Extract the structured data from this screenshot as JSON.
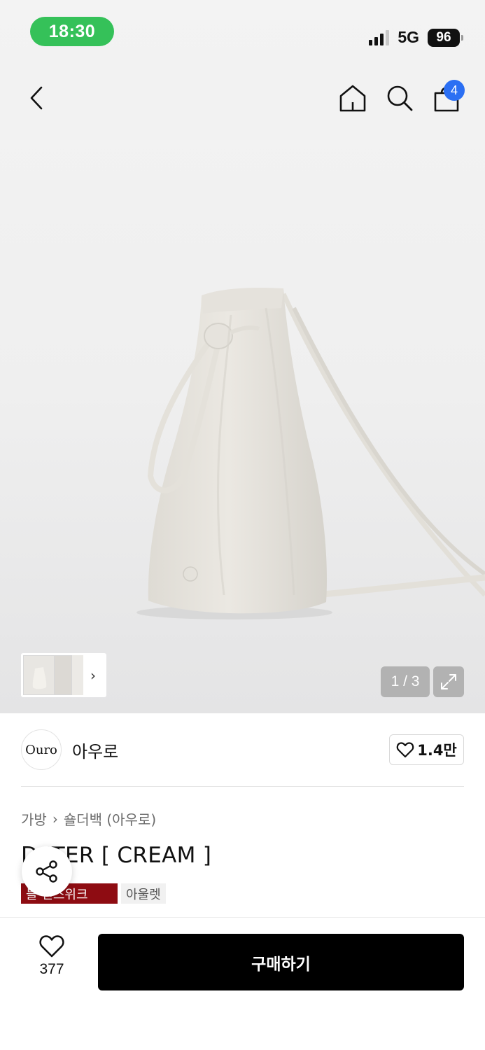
{
  "status_bar": {
    "time": "18:30",
    "network": "5G",
    "battery": "96"
  },
  "nav": {
    "cart_count": "4"
  },
  "gallery": {
    "page_indicator": "1 / 3"
  },
  "brand": {
    "logo_text": "Ouro",
    "name": "아우로",
    "likes": "1.4만"
  },
  "breadcrumb": {
    "category": "가방",
    "separator": "›",
    "subcategory": "숄더백 (아우로)"
  },
  "product": {
    "title": "D  ITER [ CREAM ]"
  },
  "tags": [
    {
      "label": "블  런스위크"
    },
    {
      "label": "아울렛"
    }
  ],
  "bottom": {
    "wish_count": "377",
    "buy_label": "구매하기"
  },
  "colors": {
    "status_green": "#35c159",
    "badge_blue": "#2b6ff3",
    "tag_red": "#8e0c12",
    "buy_black": "#000000"
  },
  "icons": [
    "back-icon",
    "home-icon",
    "search-icon",
    "shopping-bag-icon",
    "expand-icon",
    "heart-icon",
    "share-icon",
    "chevron-right-icon"
  ]
}
